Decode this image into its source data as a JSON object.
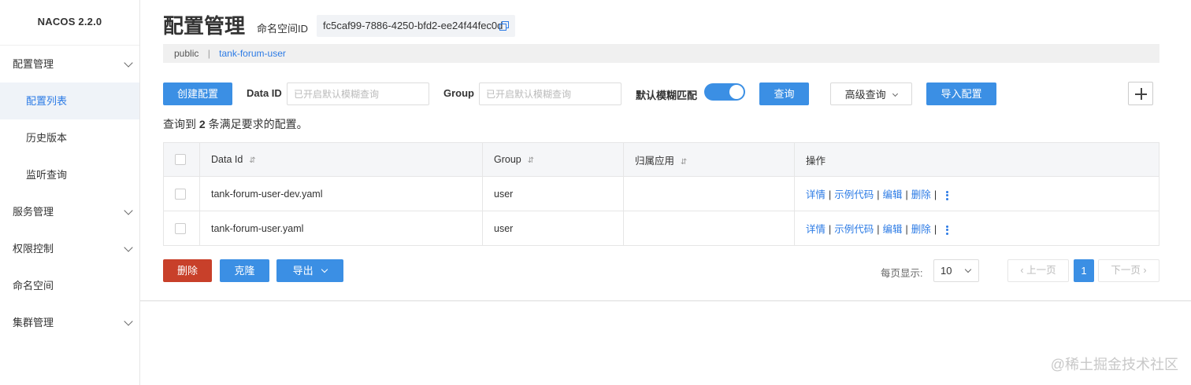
{
  "sidebar": {
    "brand": "NACOS 2.2.0",
    "items": [
      {
        "label": "配置管理"
      },
      {
        "label": "配置列表"
      },
      {
        "label": "历史版本"
      },
      {
        "label": "监听查询"
      },
      {
        "label": "服务管理"
      },
      {
        "label": "权限控制"
      },
      {
        "label": "命名空间"
      },
      {
        "label": "集群管理"
      }
    ]
  },
  "header": {
    "title": "配置管理",
    "namespace_label": "命名空间ID",
    "namespace_id": "fc5caf99-7886-4250-bfd2-ee24f44fec0d"
  },
  "breadcrumb": {
    "public": "public",
    "sep": "|",
    "current": "tank-forum-user"
  },
  "toolbar": {
    "create": "创建配置",
    "dataid_label": "Data ID",
    "dataid_placeholder": "已开启默认模糊查询",
    "group_label": "Group",
    "group_placeholder": "已开启默认模糊查询",
    "fuzzy_label": "默认模糊匹配",
    "fuzzy_on": true,
    "search": "查询",
    "advanced": "高级查询",
    "import": "导入配置"
  },
  "summary": {
    "prefix": "查询到",
    "count": "2",
    "suffix": "条满足要求的配置。"
  },
  "table": {
    "columns": [
      "Data Id",
      "Group",
      "归属应用",
      "操作"
    ],
    "rows": [
      {
        "data_id": "tank-forum-user-dev.yaml",
        "group": "user",
        "app": ""
      },
      {
        "data_id": "tank-forum-user.yaml",
        "group": "user",
        "app": ""
      }
    ],
    "actions": {
      "detail": "详情",
      "sample": "示例代码",
      "edit": "编辑",
      "delete": "删除",
      "sep": "|"
    }
  },
  "bottom": {
    "delete": "删除",
    "clone": "克隆",
    "export": "导出"
  },
  "pagination": {
    "page_size_label": "每页显示:",
    "page_size": "10",
    "prev": "上一页",
    "current": "1",
    "next": "下一页"
  },
  "watermark": "@稀土掘金技术社区",
  "colors": {
    "primary": "#3b8fe4",
    "danger": "#c8402a",
    "link": "#2c7be5"
  }
}
